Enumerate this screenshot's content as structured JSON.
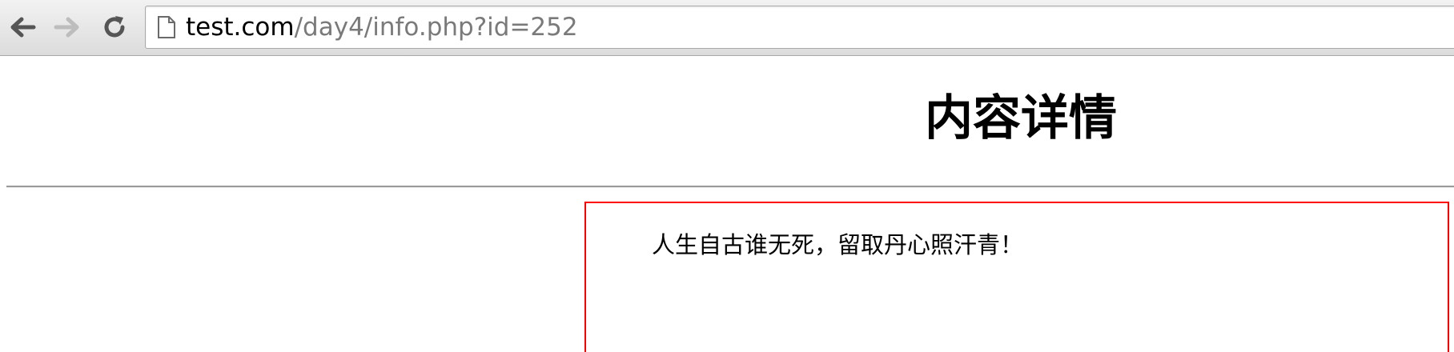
{
  "browser": {
    "url_host": "test.com",
    "url_path": "/day4/info.php?id=252",
    "icons": {
      "back": "back-arrow-icon",
      "forward": "forward-arrow-icon",
      "reload": "reload-icon",
      "page": "page-icon"
    }
  },
  "page": {
    "title": "内容详情",
    "content": "人生自古谁无死，留取丹心照汗青！",
    "colors": {
      "content_border": "#ff0000",
      "divider": "#9a9a9a"
    }
  }
}
